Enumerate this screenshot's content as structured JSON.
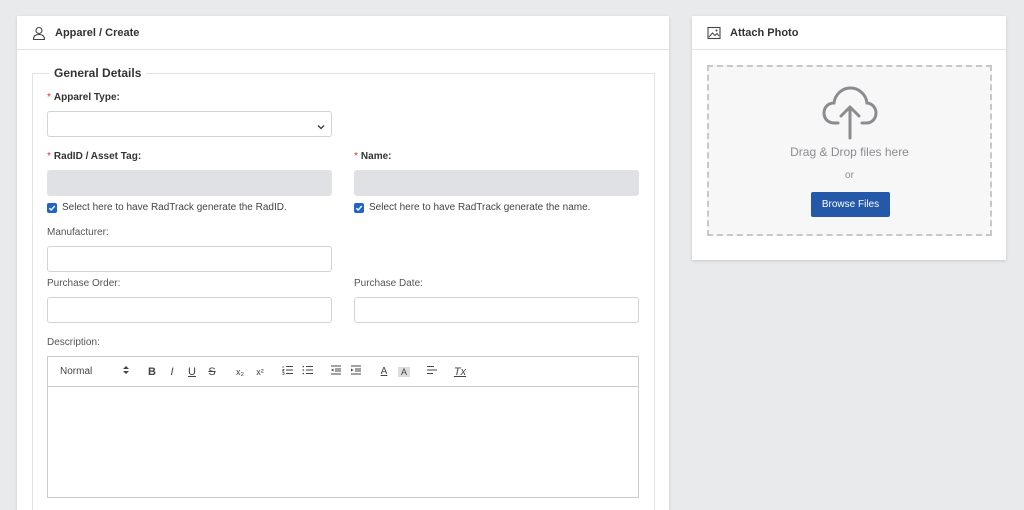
{
  "main_card": {
    "header_title": "Apparel / Create",
    "header_icon": "user-icon"
  },
  "general_details": {
    "legend": "General Details",
    "apparel_type": {
      "label": "Apparel Type:",
      "required": "*",
      "value": ""
    },
    "radid": {
      "label": "RadID / Asset Tag:",
      "required": "*",
      "value": ""
    },
    "name": {
      "label": "Name:",
      "required": "*",
      "value": ""
    },
    "radid_checkbox": {
      "label": "Select here to have RadTrack generate the RadID.",
      "checked": true
    },
    "name_checkbox": {
      "label": "Select here to have RadTrack generate the name.",
      "checked": true
    },
    "manufacturer": {
      "label": "Manufacturer:",
      "value": ""
    },
    "purchase_order": {
      "label": "Purchase Order:",
      "value": ""
    },
    "purchase_date": {
      "label": "Purchase Date:",
      "value": ""
    },
    "description": {
      "label": "Description:",
      "format_select": "Normal",
      "toolbar": {
        "bold": "B",
        "italic": "I",
        "underline": "U",
        "strike": "S",
        "subscript": "x₂",
        "superscript": "x²",
        "ordered_list": "ordered-list-icon",
        "bullet_list": "bullet-list-icon",
        "outdent": "outdent-icon",
        "indent": "indent-icon",
        "color": "A",
        "background": "A",
        "align": "align-icon",
        "clean": "Tx"
      }
    }
  },
  "photo_card": {
    "header_title": "Attach Photo",
    "header_icon": "image-icon",
    "drop_text": "Drag & Drop files here",
    "or_text": "or",
    "browse_label": "Browse Files"
  },
  "colors": {
    "accent": "#2459a9",
    "checkbox": "#1f65c4",
    "required": "#d9342b",
    "background": "#e9eaec"
  }
}
